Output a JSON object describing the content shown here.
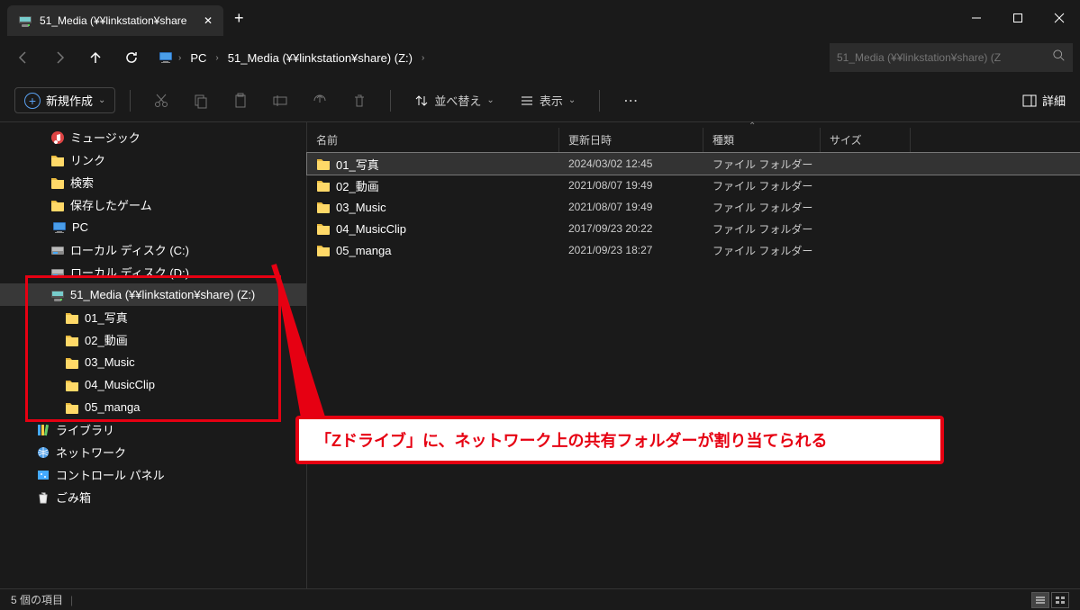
{
  "tab": {
    "title": "51_Media (¥¥linkstation¥share"
  },
  "breadcrumb": {
    "items": [
      "PC",
      "51_Media (¥¥linkstation¥share) (Z:)"
    ]
  },
  "search": {
    "placeholder": "51_Media (¥¥linkstation¥share) (Z"
  },
  "toolbar": {
    "new_label": "新規作成",
    "sort_label": "並べ替え",
    "view_label": "表示",
    "detail_label": "詳細"
  },
  "columns": {
    "name": "名前",
    "date": "更新日時",
    "type": "種類",
    "size": "サイズ"
  },
  "files": [
    {
      "name": "01_写真",
      "date": "2024/03/02 12:45",
      "type": "ファイル フォルダー"
    },
    {
      "name": "02_動画",
      "date": "2021/08/07 19:49",
      "type": "ファイル フォルダー"
    },
    {
      "name": "03_Music",
      "date": "2021/08/07 19:49",
      "type": "ファイル フォルダー"
    },
    {
      "name": "04_MusicClip",
      "date": "2017/09/23 20:22",
      "type": "ファイル フォルダー"
    },
    {
      "name": "05_manga",
      "date": "2021/09/23 18:27",
      "type": "ファイル フォルダー"
    }
  ],
  "sidebar": {
    "music": "ミュージック",
    "link": "リンク",
    "search": "検索",
    "saved_games": "保存したゲーム",
    "pc": "PC",
    "disk_c": "ローカル ディスク (C:)",
    "disk_d": "ローカル ディスク (D:)",
    "netdrive": "51_Media (¥¥linkstation¥share) (Z:)",
    "sub": [
      "01_写真",
      "02_動画",
      "03_Music",
      "04_MusicClip",
      "05_manga"
    ],
    "library": "ライブラリ",
    "network": "ネットワーク",
    "control_panel": "コントロール パネル",
    "recycle": "ごみ箱"
  },
  "status": {
    "text": "5 個の項目"
  },
  "callout": {
    "text": "「Zドライブ」に、ネットワーク上の共有フォルダーが割り当てられる"
  }
}
